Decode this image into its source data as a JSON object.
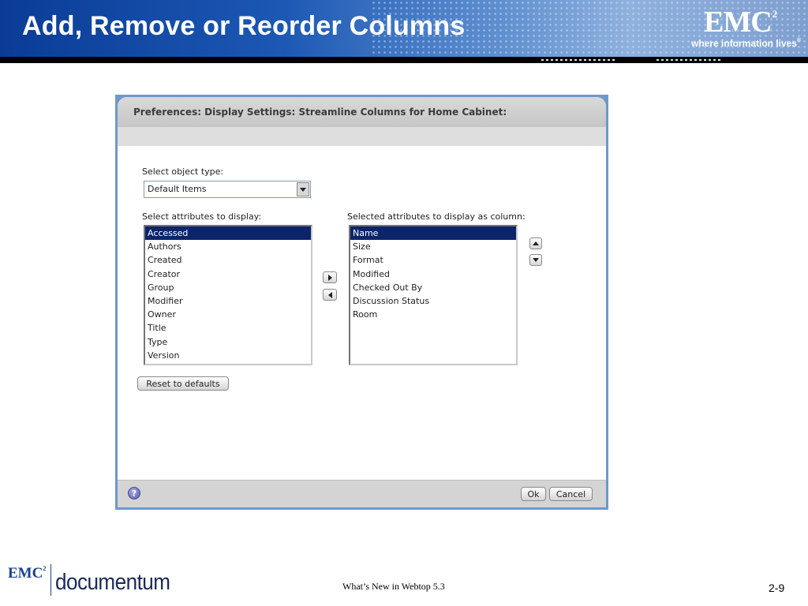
{
  "slide": {
    "title": "Add, Remove or Reorder Columns",
    "brand_logo": "EMC",
    "brand_superscript": "2",
    "tagline": "where information lives",
    "tagline_mark": "®"
  },
  "dialog": {
    "title": "Preferences: Display Settings: Streamline Columns for Home Cabinet:",
    "object_type_label": "Select object type:",
    "object_type_value": "Default Items",
    "available_label": "Select attributes to display:",
    "available_items": [
      "Accessed",
      "Authors",
      "Created",
      "Creator",
      "Group",
      "Modifier",
      "Owner",
      "Title",
      "Type",
      "Version"
    ],
    "available_selected": "Accessed",
    "selected_label": "Selected attributes to display as column:",
    "selected_items": [
      "Name",
      "Size",
      "Format",
      "Modified",
      "Checked Out By",
      "Discussion Status",
      "Room"
    ],
    "selected_selected": "Name",
    "reset_label": "Reset to defaults",
    "help_label": "?",
    "ok_label": "Ok",
    "cancel_label": "Cancel",
    "icons": [
      "arrow-right-icon",
      "arrow-left-icon",
      "arrow-up-icon",
      "arrow-down-icon",
      "help-icon",
      "dropdown-arrow-icon"
    ]
  },
  "footer": {
    "emc": "EMC",
    "emc_superscript": "2",
    "product": "documentum",
    "center_text": "What’s New in Webtop 5.3",
    "page_number": "2-9"
  },
  "colors": {
    "banner_dark": "#0a3c96",
    "selection": "#0b246a",
    "dialog_border": "#6f98c8",
    "footer_brand": "#1a3f8f"
  }
}
